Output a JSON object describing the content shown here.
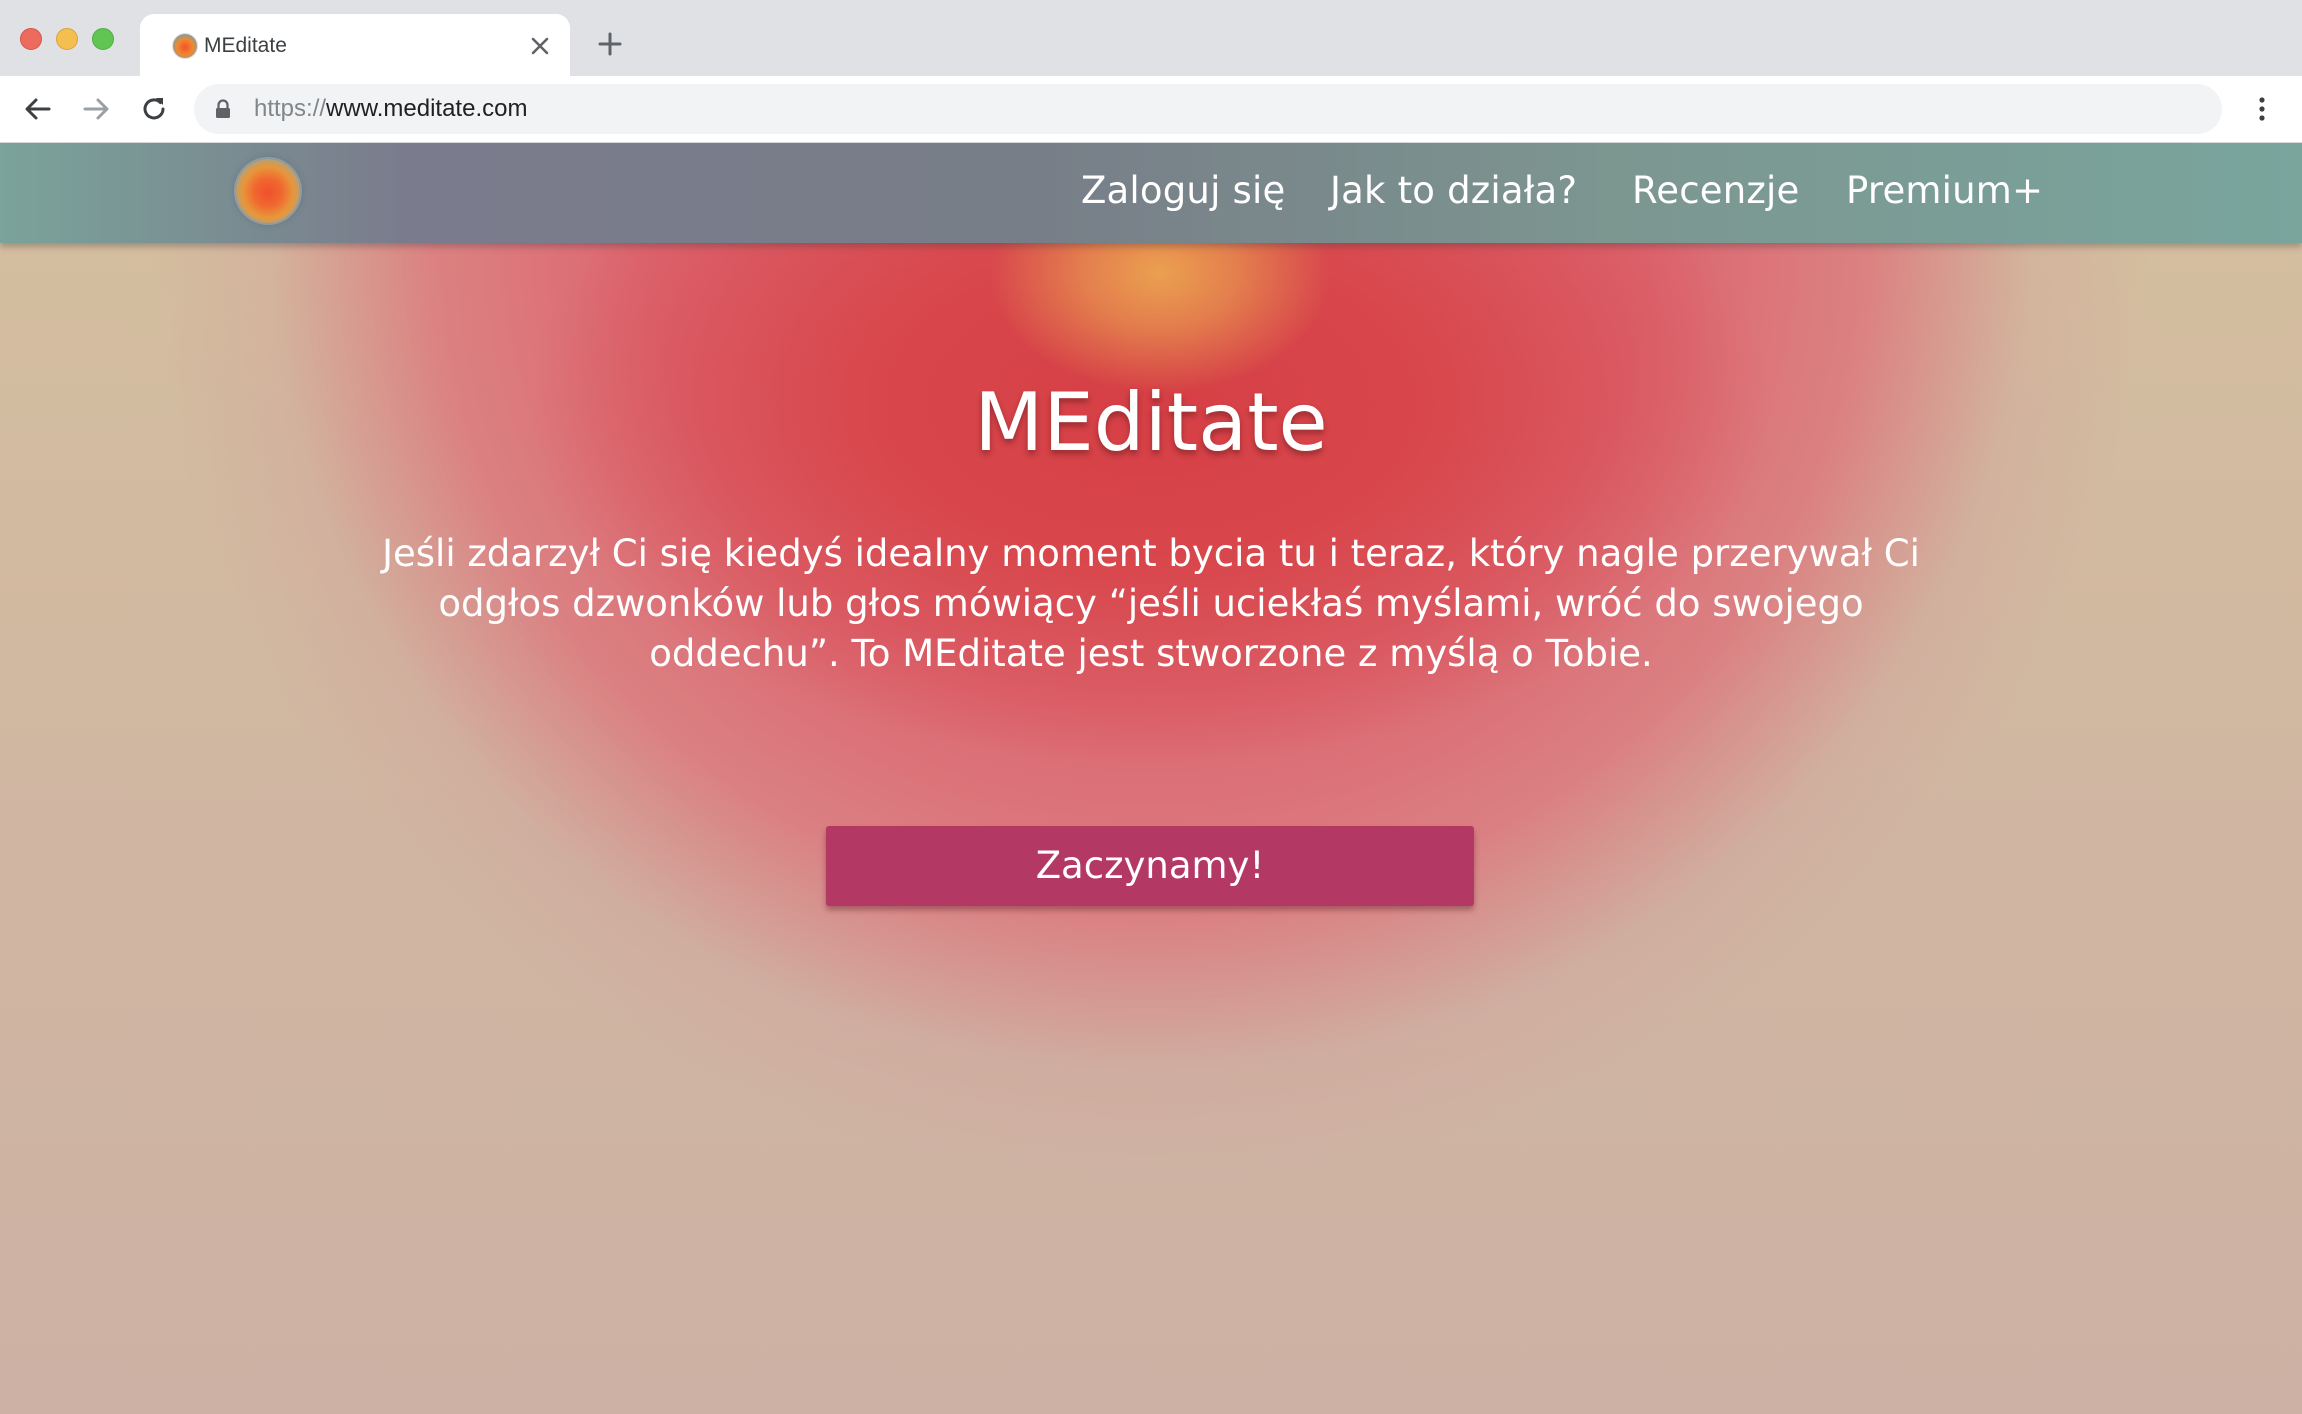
{
  "browser": {
    "tab": {
      "title": "MEditate",
      "favicon": "meditate-logo-icon",
      "close_icon": "close-icon"
    },
    "new_tab_icon": "plus-icon",
    "toolbar": {
      "back_icon": "arrow-left-icon",
      "forward_icon": "arrow-right-icon",
      "reload_icon": "reload-icon",
      "lock_icon": "lock-icon",
      "menu_icon": "kebab-menu-icon"
    },
    "address_bar": {
      "scheme": "https://",
      "host": "www.meditate.com"
    }
  },
  "site": {
    "logo": "meditate-logo-icon",
    "nav": {
      "items": [
        {
          "label": "Zaloguj się"
        },
        {
          "label": "Jak to działa?"
        },
        {
          "label": "Recenzje"
        },
        {
          "label": "Premium+"
        }
      ]
    },
    "hero": {
      "title": "MEditate",
      "lines": [
        "Jeśli zdarzył Ci się kiedyś idealny moment bycia tu i teraz, który nagle przerywał Ci",
        "odgłos dzwonków lub głos mówiący “jeśli uciekłaś myślami, wróć do swojego",
        "oddechu”. To MEditate jest stworzone z myślą o Tobie."
      ],
      "cta_label": "Zaczynamy!"
    }
  },
  "colors": {
    "nav_bar": "#7a7b8c",
    "cta_button": "#b33864",
    "hero_red": "#d53f45",
    "hero_orange": "#eca550",
    "page_background": "#cdb19f"
  }
}
